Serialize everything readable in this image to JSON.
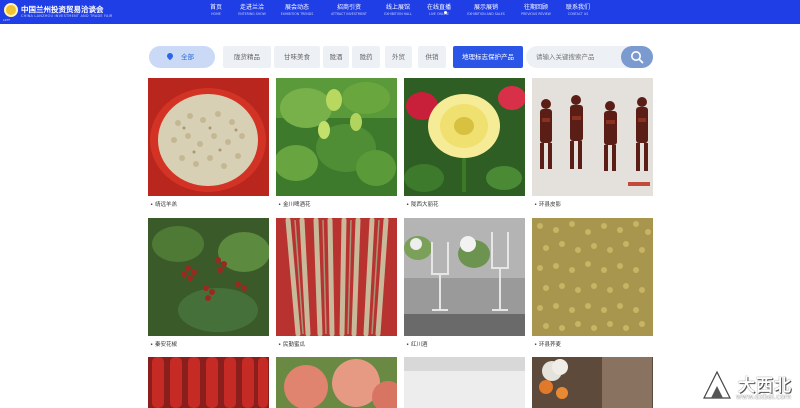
{
  "header": {
    "brand": "中国兰州投资贸易洽谈会",
    "brand_en": "CHINA LANZHOU INVESTMENT AND TRADE FAIR",
    "logo_sub": "LZTF",
    "nav": [
      {
        "cn": "首页",
        "en": "HOME"
      },
      {
        "cn": "走进兰洽",
        "en": "ENTERING SHOW"
      },
      {
        "cn": "展会动态",
        "en": "EXHIBITION TRENDS"
      },
      {
        "cn": "招商引资",
        "en": "ATTRACT INVESTMENT"
      },
      {
        "cn": "线上展馆",
        "en": "EXHIBITION HALL"
      },
      {
        "cn": "在线直播",
        "en": "LIVE ONLINE"
      },
      {
        "cn": "展示展销",
        "en": "EXHIBITION AND SALES"
      },
      {
        "cn": "往期回顾",
        "en": "PREVIOUS REVIEW"
      },
      {
        "cn": "联系我们",
        "en": "CONTACT US"
      }
    ]
  },
  "filters": {
    "all": "全部",
    "items": [
      "陇货精品",
      "甘味美食",
      "陇酒",
      "陇药",
      "外贸",
      "供销",
      "地理标志保护产品"
    ]
  },
  "search": {
    "placeholder": "请输入关键搜索产品"
  },
  "products": [
    {
      "caption": "• 靖远羊羔"
    },
    {
      "caption": "• 金川啤酒花"
    },
    {
      "caption": "• 陇西大丽花"
    },
    {
      "caption": "• 环县皮影"
    },
    {
      "caption": "• 秦安花椒"
    },
    {
      "caption": "• 民勤蜜瓜"
    },
    {
      "caption": "• 红川酒"
    },
    {
      "caption": "• 环县荞麦"
    },
    {
      "caption": ""
    },
    {
      "caption": ""
    },
    {
      "caption": ""
    },
    {
      "caption": ""
    }
  ],
  "watermark": {
    "cn": "大西北",
    "url": "www.dxbei.com"
  },
  "colors": {
    "nav": "#1f3ee6",
    "active": "#2b55e6",
    "all_bg": "#c9d9f6",
    "search_btn": "#7a9ad0"
  },
  "icons": [
    "search-icon",
    "location-pin-icon"
  ]
}
